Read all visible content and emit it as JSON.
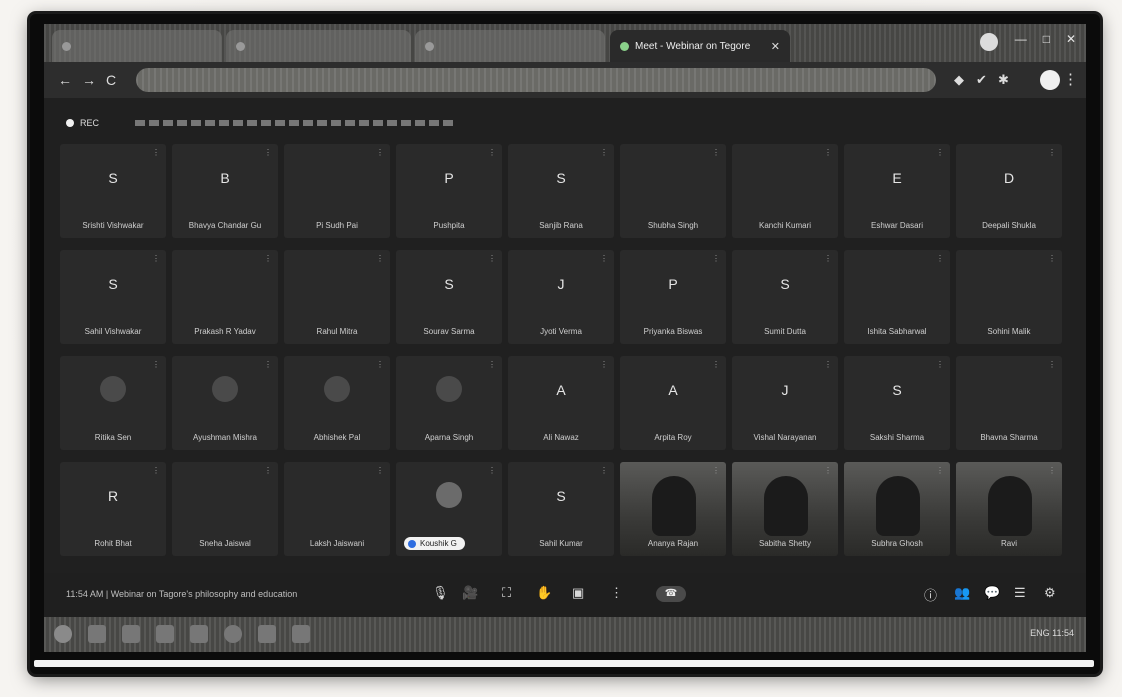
{
  "browser": {
    "tabs": [
      {
        "label": "",
        "active": false
      },
      {
        "label": "",
        "active": false
      },
      {
        "label": "",
        "active": false
      },
      {
        "label": "Meet - Webinar on Tegore",
        "active": true
      }
    ],
    "window_controls": [
      "—",
      "□",
      "✕"
    ],
    "nav": [
      "←",
      "→",
      "C"
    ],
    "menu_glyph": "⋮"
  },
  "meet": {
    "recording_label": "REC",
    "tiles": [
      {
        "initial": "S",
        "name": "Srishti Vishwakar",
        "type": "initial"
      },
      {
        "initial": "B",
        "name": "Bhavya Chandar Gu",
        "type": "initial"
      },
      {
        "initial": "",
        "name": "Pi Sudh Pai",
        "type": "initial"
      },
      {
        "initial": "P",
        "name": "Pushpita",
        "type": "initial"
      },
      {
        "initial": "S",
        "name": "Sanjib Rana",
        "type": "initial"
      },
      {
        "initial": "",
        "name": "Shubha Singh",
        "type": "initial"
      },
      {
        "initial": "",
        "name": "Kanchi Kumari",
        "type": "initial"
      },
      {
        "initial": "E",
        "name": "Eshwar Dasari",
        "type": "initial"
      },
      {
        "initial": "D",
        "name": "Deepali Shukla",
        "type": "initial"
      },
      {
        "initial": "S",
        "name": "Sahil Vishwakar",
        "type": "initial"
      },
      {
        "initial": "",
        "name": "Prakash R Yadav",
        "type": "initial"
      },
      {
        "initial": "",
        "name": "Rahul Mitra",
        "type": "initial"
      },
      {
        "initial": "S",
        "name": "Sourav Sarma",
        "type": "initial"
      },
      {
        "initial": "J",
        "name": "Jyoti Verma",
        "type": "initial"
      },
      {
        "initial": "P",
        "name": "Priyanka Biswas",
        "type": "initial"
      },
      {
        "initial": "S",
        "name": "Sumit Dutta",
        "type": "initial"
      },
      {
        "initial": "",
        "name": "Ishita Sabharwal",
        "type": "initial"
      },
      {
        "initial": "",
        "name": "Sohini Malik",
        "type": "initial"
      },
      {
        "initial": "",
        "name": "Ritika Sen",
        "type": "avatar"
      },
      {
        "initial": "",
        "name": "Ayushman Mishra",
        "type": "avatar"
      },
      {
        "initial": "",
        "name": "Abhishek Pal",
        "type": "avatar"
      },
      {
        "initial": "",
        "name": "Aparna Singh",
        "type": "avatar"
      },
      {
        "initial": "A",
        "name": "Ali Nawaz",
        "type": "initial"
      },
      {
        "initial": "A",
        "name": "Arpita Roy",
        "type": "initial"
      },
      {
        "initial": "J",
        "name": "Vishal Narayanan",
        "type": "initial"
      },
      {
        "initial": "S",
        "name": "Sakshi Sharma",
        "type": "initial"
      },
      {
        "initial": "",
        "name": "Bhavna Sharma",
        "type": "initial"
      },
      {
        "initial": "R",
        "name": "Rohit Bhat",
        "type": "initial"
      },
      {
        "initial": "",
        "name": "Sneha Jaiswal",
        "type": "initial"
      },
      {
        "initial": "",
        "name": "Laksh Jaiswani",
        "type": "initial"
      },
      {
        "initial": "",
        "name": "Koushik G",
        "type": "self"
      },
      {
        "initial": "S",
        "name": "Sahil Kumar",
        "type": "initial"
      },
      {
        "initial": "",
        "name": "Ananya Rajan",
        "type": "video"
      },
      {
        "initial": "",
        "name": "Sabitha Shetty",
        "type": "video"
      },
      {
        "initial": "",
        "name": "Subhra Ghosh",
        "type": "video"
      },
      {
        "initial": "",
        "name": "Ravi",
        "type": "video"
      }
    ],
    "meeting_info": "11:54 AM  |  Webinar on Tagore's philosophy and education",
    "controls": [
      "🎙",
      "🎥",
      "⛶",
      "✋",
      "▣",
      "⋮"
    ],
    "right_controls": [
      "ⓘ",
      "👥",
      "💬",
      "☰",
      "⚙"
    ],
    "hangup_glyph": "☎"
  },
  "taskbar": {
    "tray": "ENG  11:54"
  }
}
